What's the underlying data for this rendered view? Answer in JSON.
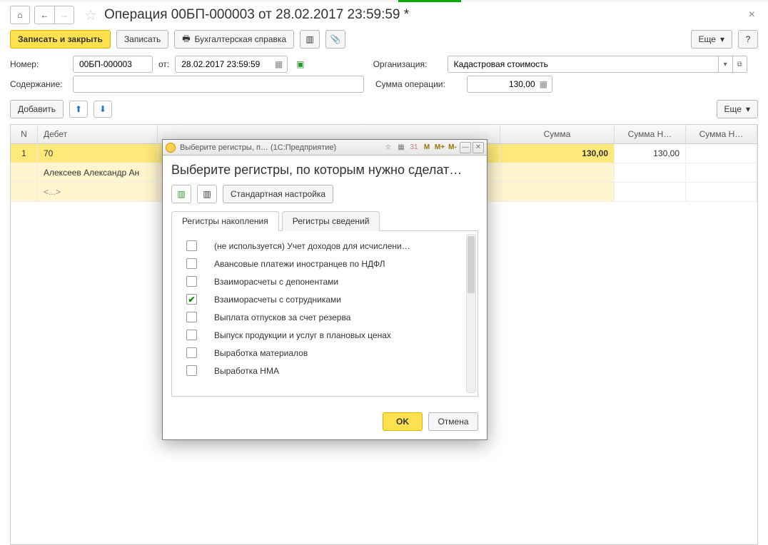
{
  "header": {
    "title": "Операция 00БП-000003 от 28.02.2017 23:59:59 *"
  },
  "toolbar": {
    "save_close": "Записать и закрыть",
    "save": "Записать",
    "acc_ref": "Бухгалтерская справка",
    "more": "Еще",
    "help": "?"
  },
  "form": {
    "number_label": "Номер:",
    "number_value": "00БП-000003",
    "from_label": "от:",
    "date_value": "28.02.2017 23:59:59",
    "org_label": "Организация:",
    "org_value": "Кадастровая стоимость",
    "content_label": "Содержание:",
    "content_value": "",
    "sum_label": "Сумма операции:",
    "sum_value": "130,00"
  },
  "table_toolbar": {
    "add": "Добавить",
    "more": "Еще"
  },
  "table": {
    "headers": {
      "n": "N",
      "debit": "Дебет",
      "sum": "Сумма",
      "sumN1": "Сумма Н…",
      "sumN2": "Сумма Н…"
    },
    "rows": [
      {
        "n": "1",
        "debit": "70",
        "sum": "130,00",
        "sumN": "130,00"
      },
      {
        "debit": "Алексеев Александр Ан"
      },
      {
        "debit": "<...>"
      }
    ]
  },
  "modal": {
    "titlebar": "Выберите регистры, п…   (1С:Предприятие)",
    "heading": "Выберите регистры, по которым нужно сделат…",
    "std_btn": "Стандартная настройка",
    "tabs": {
      "accum": "Регистры накопления",
      "info": "Регистры сведений"
    },
    "items": [
      {
        "checked": false,
        "label": "(не используется) Учет доходов для исчислени…"
      },
      {
        "checked": false,
        "label": "Авансовые платежи иностранцев по НДФЛ"
      },
      {
        "checked": false,
        "label": "Взаиморасчеты с депонентами"
      },
      {
        "checked": true,
        "label": "Взаиморасчеты с сотрудниками"
      },
      {
        "checked": false,
        "label": "Выплата отпусков за счет резерва"
      },
      {
        "checked": false,
        "label": "Выпуск продукции и услуг в плановых ценах"
      },
      {
        "checked": false,
        "label": "Выработка материалов"
      },
      {
        "checked": false,
        "label": "Выработка НМА"
      }
    ],
    "ok": "OK",
    "cancel": "Отмена"
  },
  "icons": {
    "home": "⌂",
    "back": "←",
    "fwd": "→",
    "star": "☆",
    "print": "🖶",
    "doc": "▥",
    "clip": "📎",
    "up": "⬆",
    "down": "⬇",
    "cal": "📅",
    "check": "✔",
    "dd": "▾",
    "ext": "⧉",
    "lock": "▣",
    "m": "M",
    "mplus": "M+",
    "mminus": "M-",
    "min": "—",
    "close": "✕"
  }
}
